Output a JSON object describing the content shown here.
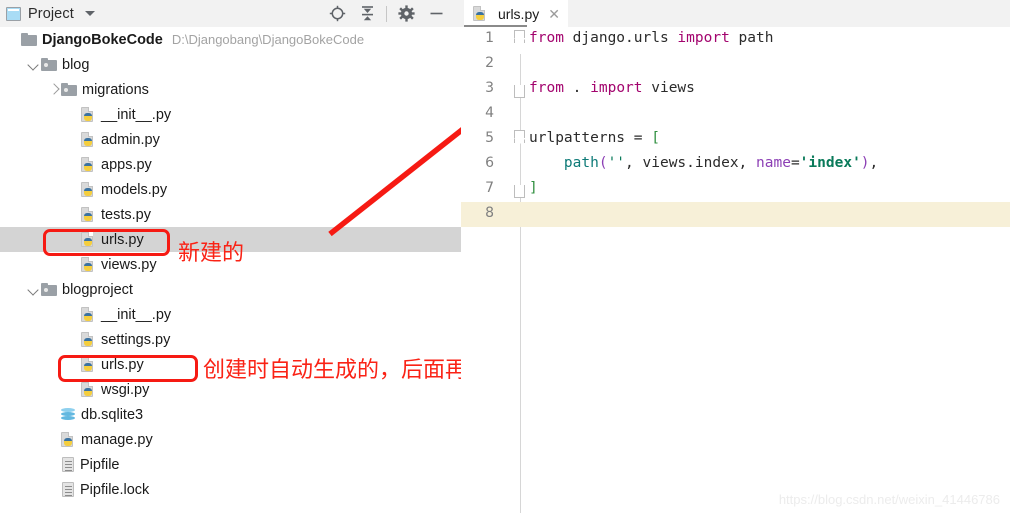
{
  "window": {
    "panel_title": "Project",
    "panel_icon": "project-panel-icon",
    "dropdown_icon": "chevron-down-icon"
  },
  "toolbar": {
    "buttons": [
      {
        "name": "locate-in-tree-icon",
        "label": "Select Opened File"
      },
      {
        "name": "collapse-all-icon",
        "label": "Collapse All"
      },
      {
        "name": "gear-icon",
        "label": "Settings"
      },
      {
        "name": "minimize-icon",
        "label": "Hide"
      }
    ]
  },
  "tree": [
    {
      "label": "DjangoBokeCode",
      "path": "D:\\Djangobang\\DjangoBokeCode",
      "icon": "folder-icon",
      "indent": 0,
      "arrow": "open-hidden",
      "bold": true,
      "selected": false
    },
    {
      "label": "blog",
      "path": "",
      "icon": "folder-module-icon",
      "indent": 1,
      "arrow": "open",
      "bold": false,
      "selected": false
    },
    {
      "label": "migrations",
      "path": "",
      "icon": "folder-module-icon",
      "indent": 2,
      "arrow": "closed",
      "bold": false,
      "selected": false
    },
    {
      "label": "__init__.py",
      "path": "",
      "icon": "python-file-icon",
      "indent": 3,
      "arrow": "none",
      "bold": false,
      "selected": false
    },
    {
      "label": "admin.py",
      "path": "",
      "icon": "python-file-icon",
      "indent": 3,
      "arrow": "none",
      "bold": false,
      "selected": false
    },
    {
      "label": "apps.py",
      "path": "",
      "icon": "python-file-icon",
      "indent": 3,
      "arrow": "none",
      "bold": false,
      "selected": false
    },
    {
      "label": "models.py",
      "path": "",
      "icon": "python-file-icon",
      "indent": 3,
      "arrow": "none",
      "bold": false,
      "selected": false
    },
    {
      "label": "tests.py",
      "path": "",
      "icon": "python-file-icon",
      "indent": 3,
      "arrow": "none",
      "bold": false,
      "selected": false
    },
    {
      "label": "urls.py",
      "path": "",
      "icon": "python-file-icon",
      "indent": 3,
      "arrow": "none",
      "bold": false,
      "selected": true
    },
    {
      "label": "views.py",
      "path": "",
      "icon": "python-file-icon",
      "indent": 3,
      "arrow": "none",
      "bold": false,
      "selected": false
    },
    {
      "label": "blogproject",
      "path": "",
      "icon": "folder-module-icon",
      "indent": 1,
      "arrow": "open",
      "bold": false,
      "selected": false
    },
    {
      "label": "__init__.py",
      "path": "",
      "icon": "python-file-icon",
      "indent": 3,
      "arrow": "none",
      "bold": false,
      "selected": false
    },
    {
      "label": "settings.py",
      "path": "",
      "icon": "python-file-icon",
      "indent": 3,
      "arrow": "none",
      "bold": false,
      "selected": false
    },
    {
      "label": "urls.py",
      "path": "",
      "icon": "python-file-icon",
      "indent": 3,
      "arrow": "none",
      "bold": false,
      "selected": false
    },
    {
      "label": "wsgi.py",
      "path": "",
      "icon": "python-file-icon",
      "indent": 3,
      "arrow": "none",
      "bold": false,
      "selected": false
    },
    {
      "label": "db.sqlite3",
      "path": "",
      "icon": "database-icon",
      "indent": 2,
      "arrow": "none",
      "bold": false,
      "selected": false
    },
    {
      "label": "manage.py",
      "path": "",
      "icon": "python-file-icon",
      "indent": 2,
      "arrow": "none",
      "bold": false,
      "selected": false
    },
    {
      "label": "Pipfile",
      "path": "",
      "icon": "text-file-icon",
      "indent": 2,
      "arrow": "none",
      "bold": false,
      "selected": false
    },
    {
      "label": "Pipfile.lock",
      "path": "",
      "icon": "text-file-icon",
      "indent": 2,
      "arrow": "none",
      "bold": false,
      "selected": false
    }
  ],
  "annotations": {
    "note_new_file": "新建的",
    "note_auto_generated": "创建时自动生成的，后面再配置",
    "arrow_color": "#f61a13",
    "box_color": "#f61a13"
  },
  "editor": {
    "tab": {
      "label": "urls.py",
      "icon": "python-file-icon",
      "close_icon": "close-icon"
    },
    "current_line": 8,
    "lines": [
      {
        "num": "1",
        "fold": "tri",
        "tokens": [
          {
            "t": "from",
            "c": "kw"
          },
          {
            "t": " django.urls ",
            "c": "pln"
          },
          {
            "t": "import",
            "c": "kw"
          },
          {
            "t": " path",
            "c": "pln"
          }
        ]
      },
      {
        "num": "2",
        "fold": "none",
        "tokens": []
      },
      {
        "num": "3",
        "fold": "endc",
        "tokens": [
          {
            "t": "from",
            "c": "kw"
          },
          {
            "t": " . ",
            "c": "pln"
          },
          {
            "t": "import",
            "c": "kw"
          },
          {
            "t": " views",
            "c": "pln"
          }
        ]
      },
      {
        "num": "4",
        "fold": "none",
        "tokens": []
      },
      {
        "num": "5",
        "fold": "tri",
        "tokens": [
          {
            "t": "urlpatterns ",
            "c": "pln"
          },
          {
            "t": "=",
            "c": "op"
          },
          {
            "t": " ",
            "c": "pln"
          },
          {
            "t": "[",
            "c": "brk"
          }
        ]
      },
      {
        "num": "6",
        "fold": "none",
        "indent": "    ",
        "tokens": [
          {
            "t": "path",
            "c": "fn"
          },
          {
            "t": "(",
            "c": "kwarg"
          },
          {
            "t": "''",
            "c": "str2"
          },
          {
            "t": ", ",
            "c": "pln"
          },
          {
            "t": "views.index",
            "c": "pln"
          },
          {
            "t": ", ",
            "c": "pln"
          },
          {
            "t": "name",
            "c": "kwarg"
          },
          {
            "t": "=",
            "c": "op"
          },
          {
            "t": "'",
            "c": "str"
          },
          {
            "t": "index",
            "c": "str"
          },
          {
            "t": "'",
            "c": "str"
          },
          {
            "t": ")",
            "c": "kwarg"
          },
          {
            "t": ",",
            "c": "pln"
          }
        ]
      },
      {
        "num": "7",
        "fold": "endc",
        "tokens": [
          {
            "t": "]",
            "c": "brk"
          }
        ]
      },
      {
        "num": "8",
        "fold": "none",
        "tokens": []
      }
    ]
  },
  "watermark": "https://blog.csdn.net/weixin_41446786"
}
